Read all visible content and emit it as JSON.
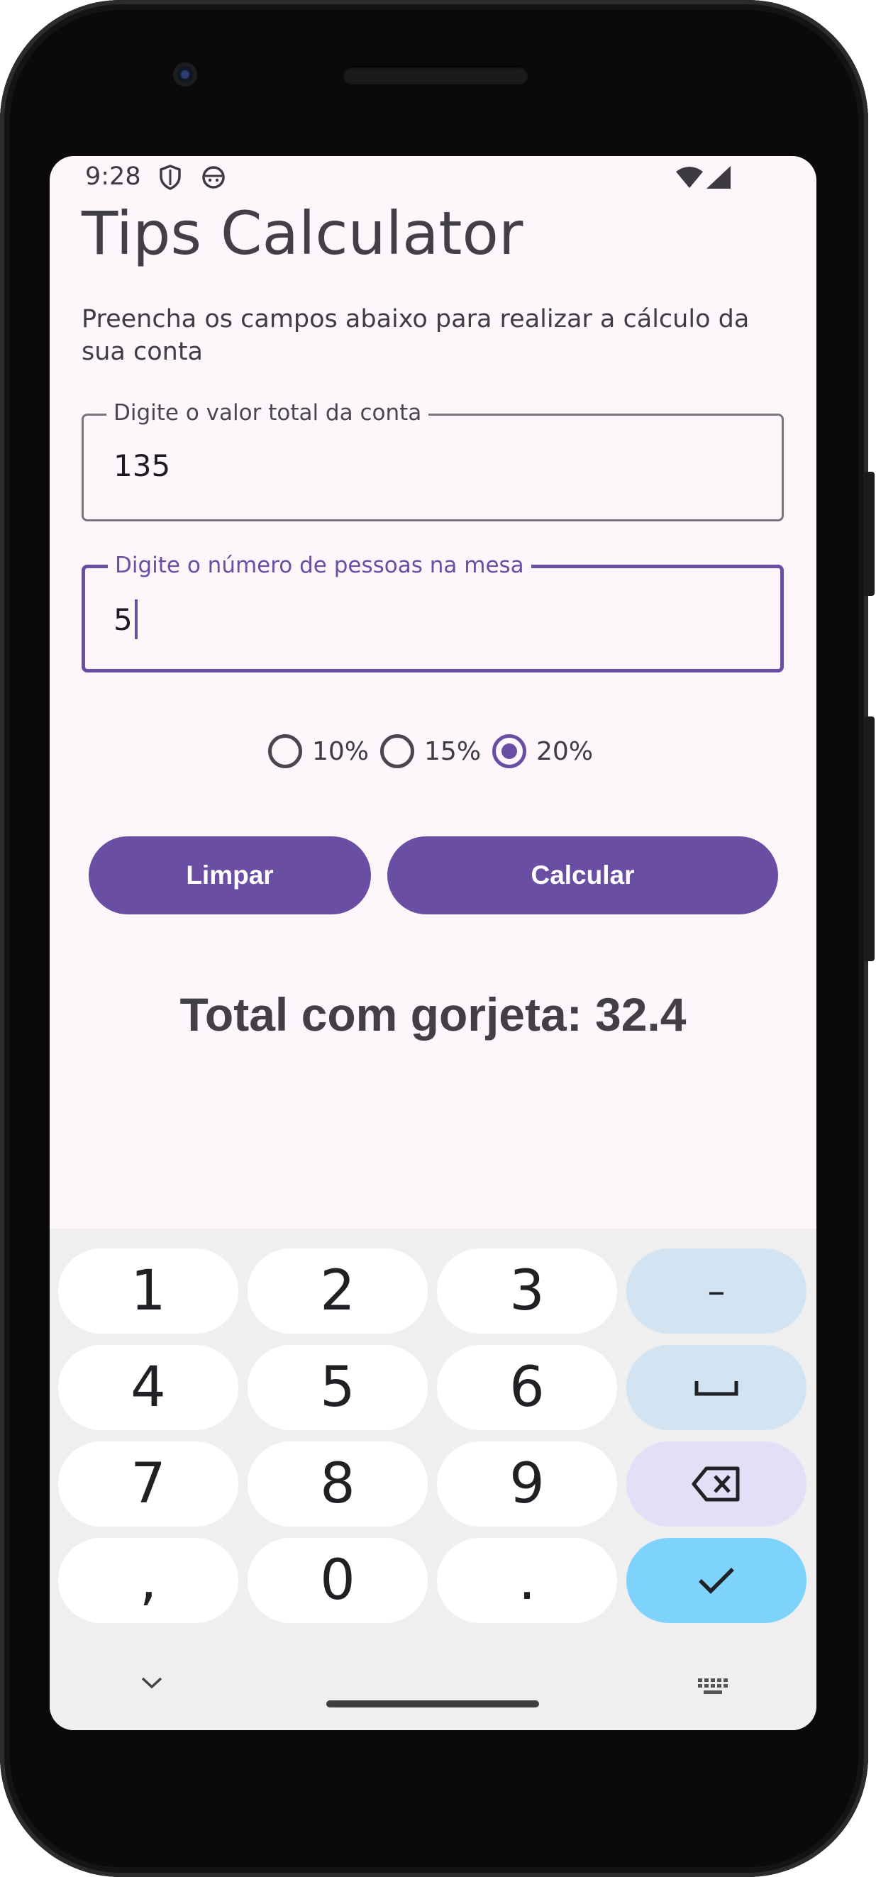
{
  "status_bar": {
    "time": "9:28"
  },
  "app": {
    "title": "Tips Calculator",
    "subtitle": "Preencha os campos abaixo para realizar a cálculo da sua conta"
  },
  "form": {
    "bill_field": {
      "label": "Digite o valor total da conta",
      "value": "135"
    },
    "people_field": {
      "label": "Digite o número de pessoas na mesa",
      "value": "5"
    },
    "tip_options": [
      "10%",
      "15%",
      "20%"
    ],
    "selected_tip": "20%"
  },
  "buttons": {
    "clear_label": "Limpar",
    "calculate_label": "Calcular"
  },
  "result": {
    "text": "Total com gorjeta: 32.4"
  },
  "keyboard": {
    "keys": [
      "1",
      "2",
      "3",
      "–",
      "4",
      "5",
      "6",
      "7",
      "8",
      "9",
      ",",
      "0",
      "."
    ],
    "special_keys": [
      "minus-key",
      "space-key",
      "backspace-key",
      "done-key"
    ]
  },
  "colors": {
    "primary": "#6a4ea3",
    "background": "#fdf7fb",
    "keyboard_bg": "#efefef",
    "done_key": "#7dd3fc"
  }
}
